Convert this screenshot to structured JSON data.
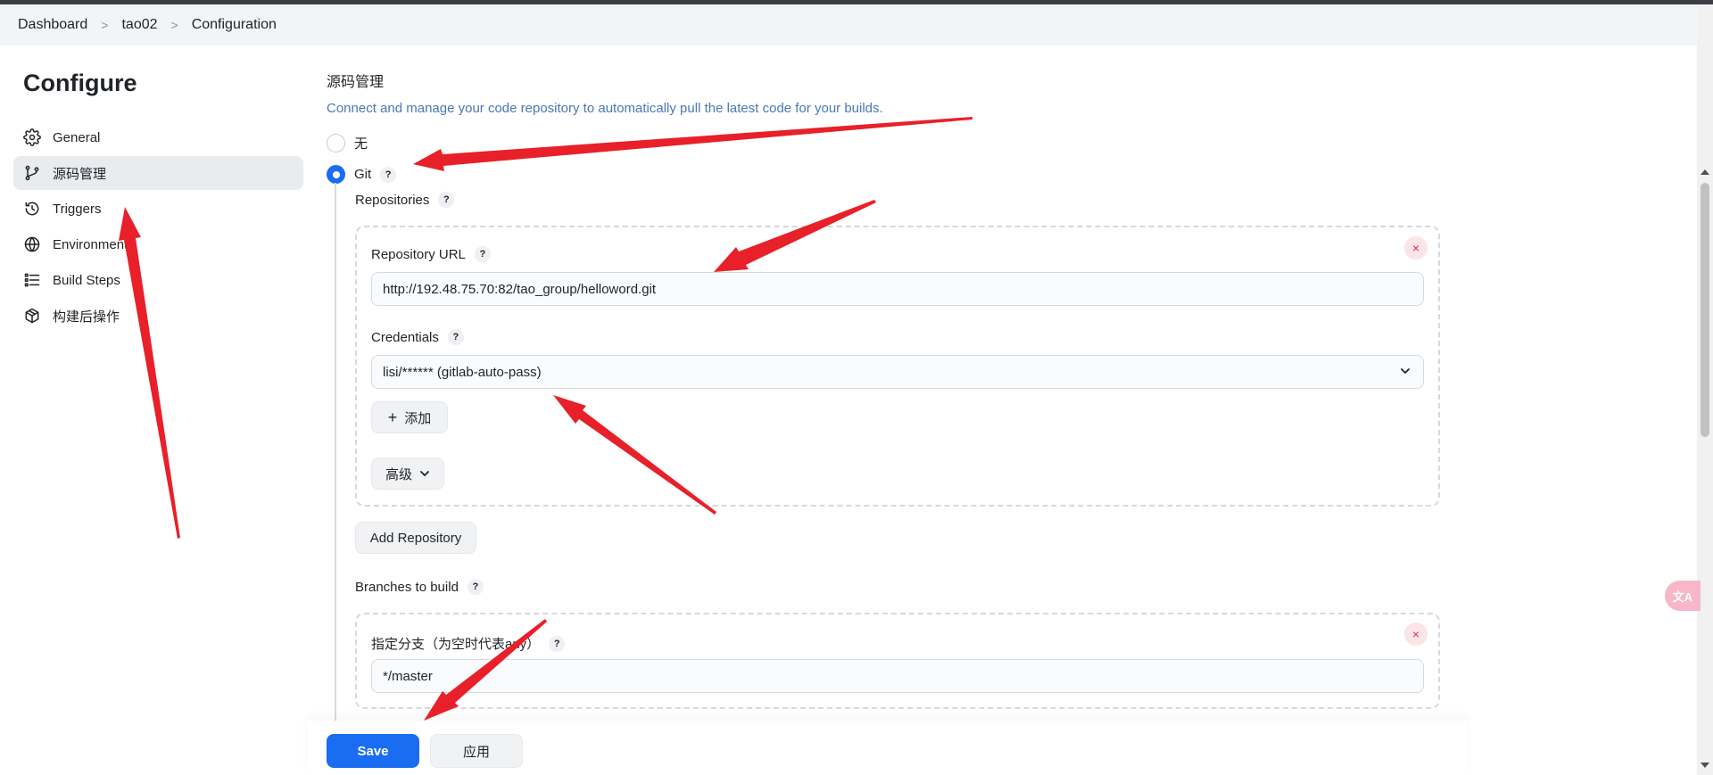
{
  "breadcrumb": {
    "items": [
      "Dashboard",
      "tao02",
      "Configuration"
    ],
    "separator": ">"
  },
  "sidebar": {
    "title": "Configure",
    "items": [
      {
        "label": "General",
        "icon": "gear-icon",
        "active": false
      },
      {
        "label": "源码管理",
        "icon": "git-branch-icon",
        "active": true
      },
      {
        "label": "Triggers",
        "icon": "clock-icon",
        "active": false
      },
      {
        "label": "Environment",
        "icon": "globe-icon",
        "active": false
      },
      {
        "label": "Build Steps",
        "icon": "list-icon",
        "active": false
      },
      {
        "label": "构建后操作",
        "icon": "package-icon",
        "active": false
      }
    ]
  },
  "scm": {
    "title": "源码管理",
    "description": "Connect and manage your code repository to automatically pull the latest code for your builds.",
    "options": [
      {
        "label": "无",
        "checked": false
      },
      {
        "label": "Git",
        "checked": true
      }
    ],
    "help_glyph": "?",
    "repositories_label": "Repositories",
    "repository": {
      "url_label": "Repository URL",
      "url_value": "http://192.48.75.70:82/tao_group/helloword.git",
      "credentials_label": "Credentials",
      "credentials_value": "lisi/****** (gitlab-auto-pass)",
      "add_button": "添加",
      "add_glyph": "+",
      "advanced_button": "高级",
      "close_glyph": "×"
    },
    "add_repository_button": "Add Repository",
    "branches_label": "Branches to build",
    "branch": {
      "specifier_label": "指定分支（为空时代表any）",
      "specifier_value": "*/master",
      "close_glyph": "×"
    }
  },
  "footer": {
    "save_button": "Save",
    "apply_button": "应用"
  },
  "translate_widget": {
    "glyph": "文A"
  },
  "colors": {
    "primary": "#1a6cf0",
    "annotation_arrow": "#e8202a",
    "description": "#4a79b5",
    "close": "#d8334a"
  }
}
